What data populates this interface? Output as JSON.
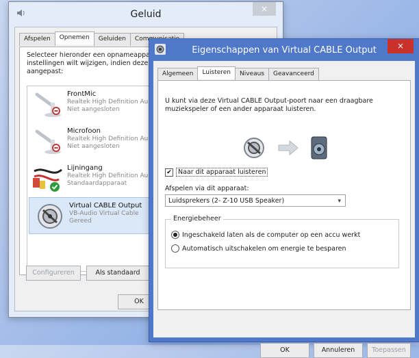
{
  "sound_window": {
    "title": "Geluid",
    "close_glyph": "×",
    "tabs": [
      "Afspelen",
      "Opnemen",
      "Geluiden",
      "Communicatie"
    ],
    "active_tab": "Opnemen",
    "intro": "Selecteer hieronder een opnameapparaat waarvan u de instellingen wilt wijzigen, indien deze moeten worden aangepast:",
    "devices": [
      {
        "name": "FrontMic",
        "driver": "Realtek High Definition Audio",
        "status": "Niet aangesloten",
        "icon": "microphone-icon"
      },
      {
        "name": "Microfoon",
        "driver": "Realtek High Definition Audio",
        "status": "Niet aangesloten",
        "icon": "microphone-icon"
      },
      {
        "name": "Lijningang",
        "driver": "Realtek High Definition Audio",
        "status": "Standaardapparaat",
        "icon": "line-in-cable-icon"
      },
      {
        "name": "Virtual CABLE Output",
        "driver": "VB-Audio Virtual Cable",
        "status": "Gereed",
        "icon": "virtual-cable-icon",
        "selected": true
      }
    ],
    "buttons": {
      "configure": "Configureren",
      "set_default": "Als standaard",
      "ok": "OK"
    }
  },
  "props_window": {
    "title": "Eigenschappen van Virtual CABLE Output",
    "close_glyph": "×",
    "tabs": [
      "Algemeen",
      "Luisteren",
      "Niveaus",
      "Geavanceerd"
    ],
    "active_tab": "Luisteren",
    "intro": "U kunt via deze Virtual CABLE Output-poort naar een draagbare muziekspeler of een ander apparaat luisteren.",
    "listen_checkbox": {
      "label": "Naar dit apparaat luisteren",
      "checked": true
    },
    "playback_label": "Afspelen via dit apparaat:",
    "playback_value": "Luidsprekers (2- Z-10 USB Speaker)",
    "power": {
      "title": "Energiebeheer",
      "options": [
        {
          "label": "Ingeschakeld laten als de computer op een accu werkt",
          "selected": true
        },
        {
          "label": "Automatisch uitschakelen om energie te besparen",
          "selected": false
        }
      ]
    },
    "buttons": {
      "ok": "OK",
      "cancel": "Annuleren",
      "apply": "Toepassen"
    }
  },
  "colors": {
    "props_titlebar": "#4f78c9",
    "close_red": "#c9312a",
    "selected_row": "#dbe8f7",
    "status_ok_green": "#2e9b3c"
  }
}
